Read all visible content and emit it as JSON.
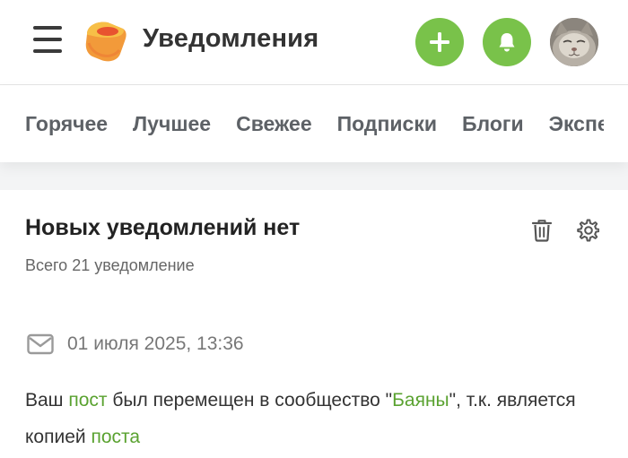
{
  "header": {
    "title": "Уведомления",
    "menu_icon": "hamburger-menu-icon",
    "logo_icon": "pikabu-logo-icon",
    "add_icon": "plus-icon",
    "bell_icon": "bell-icon",
    "accent_color": "#79c24a"
  },
  "tabs": [
    "Горячее",
    "Лучшее",
    "Свежее",
    "Подписки",
    "Блоги",
    "Эксперты"
  ],
  "notifications_panel": {
    "title": "Новых уведомлений нет",
    "total": "Всего 21 уведомление",
    "delete_icon": "trash-icon",
    "settings_icon": "gear-icon"
  },
  "notification": {
    "icon": "envelope-icon",
    "date": "01 июля 2025, 13:36",
    "text_1": "Ваш ",
    "link_post": "пост",
    "text_2": " был перемещен в сообщество \"",
    "link_community": "Баяны",
    "text_3": "\", т.к. является копией ",
    "link_original": "поста",
    "link_color": "#5aa230"
  }
}
